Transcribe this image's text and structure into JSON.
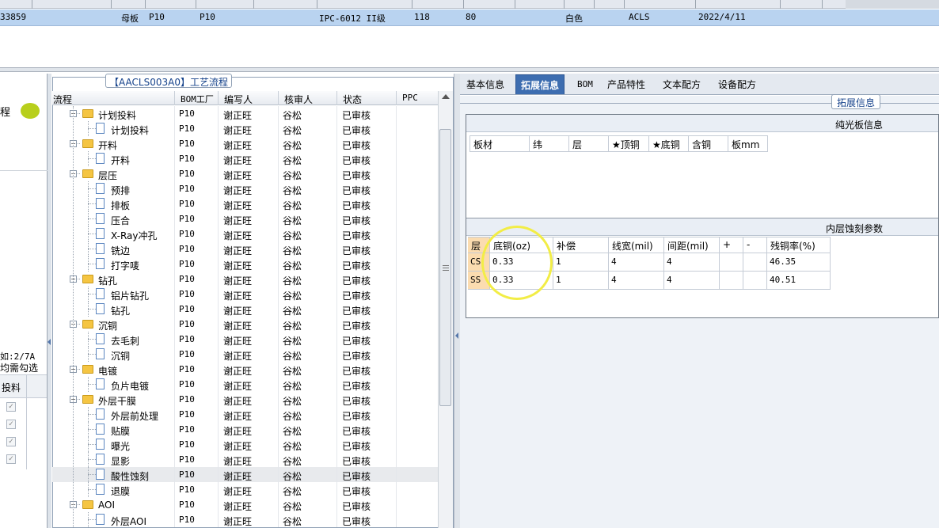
{
  "top_row": {
    "code": "33859",
    "type": "母板",
    "factory": "P10",
    "factory2": "P10",
    "grade": "IPC-6012 II级",
    "num1": "118",
    "num2": "80",
    "color": "白色",
    "brand": "ACLS",
    "date": "2022/4/11"
  },
  "left_panel": {
    "label_cheng": "程",
    "note_line1": "如:2/7A",
    "note_line2": "均需勾选",
    "col_feed": "投料"
  },
  "flow": {
    "title": "【AACLS003A0】工艺流程",
    "headers": [
      "流程",
      "BOM工厂",
      "编写人",
      "核审人",
      "状态",
      "PPC"
    ],
    "rows": [
      {
        "name": "计划投料",
        "level": 0,
        "factory": "P10",
        "writer": "谢正旺",
        "reviewer": "谷松",
        "status": "已审核"
      },
      {
        "name": "计划投料",
        "level": 1,
        "factory": "P10",
        "writer": "谢正旺",
        "reviewer": "谷松",
        "status": "已审核"
      },
      {
        "name": "开料",
        "level": 0,
        "factory": "P10",
        "writer": "谢正旺",
        "reviewer": "谷松",
        "status": "已审核"
      },
      {
        "name": "开料",
        "level": 1,
        "factory": "P10",
        "writer": "谢正旺",
        "reviewer": "谷松",
        "status": "已审核"
      },
      {
        "name": "层压",
        "level": 0,
        "factory": "P10",
        "writer": "谢正旺",
        "reviewer": "谷松",
        "status": "已审核"
      },
      {
        "name": "预排",
        "level": 1,
        "factory": "P10",
        "writer": "谢正旺",
        "reviewer": "谷松",
        "status": "已审核"
      },
      {
        "name": "排板",
        "level": 1,
        "factory": "P10",
        "writer": "谢正旺",
        "reviewer": "谷松",
        "status": "已审核"
      },
      {
        "name": "压合",
        "level": 1,
        "factory": "P10",
        "writer": "谢正旺",
        "reviewer": "谷松",
        "status": "已审核"
      },
      {
        "name": "X-Ray冲孔",
        "level": 1,
        "factory": "P10",
        "writer": "谢正旺",
        "reviewer": "谷松",
        "status": "已审核"
      },
      {
        "name": "铣边",
        "level": 1,
        "factory": "P10",
        "writer": "谢正旺",
        "reviewer": "谷松",
        "status": "已审核"
      },
      {
        "name": "打字唛",
        "level": 1,
        "factory": "P10",
        "writer": "谢正旺",
        "reviewer": "谷松",
        "status": "已审核"
      },
      {
        "name": "钻孔",
        "level": 0,
        "factory": "P10",
        "writer": "谢正旺",
        "reviewer": "谷松",
        "status": "已审核"
      },
      {
        "name": "铝片钻孔",
        "level": 1,
        "factory": "P10",
        "writer": "谢正旺",
        "reviewer": "谷松",
        "status": "已审核"
      },
      {
        "name": "钻孔",
        "level": 1,
        "factory": "P10",
        "writer": "谢正旺",
        "reviewer": "谷松",
        "status": "已审核"
      },
      {
        "name": "沉铜",
        "level": 0,
        "factory": "P10",
        "writer": "谢正旺",
        "reviewer": "谷松",
        "status": "已审核"
      },
      {
        "name": "去毛刺",
        "level": 1,
        "factory": "P10",
        "writer": "谢正旺",
        "reviewer": "谷松",
        "status": "已审核"
      },
      {
        "name": "沉铜",
        "level": 1,
        "factory": "P10",
        "writer": "谢正旺",
        "reviewer": "谷松",
        "status": "已审核"
      },
      {
        "name": "电镀",
        "level": 0,
        "factory": "P10",
        "writer": "谢正旺",
        "reviewer": "谷松",
        "status": "已审核"
      },
      {
        "name": "负片电镀",
        "level": 1,
        "factory": "P10",
        "writer": "谢正旺",
        "reviewer": "谷松",
        "status": "已审核"
      },
      {
        "name": "外层干膜",
        "level": 0,
        "factory": "P10",
        "writer": "谢正旺",
        "reviewer": "谷松",
        "status": "已审核"
      },
      {
        "name": "外层前处理",
        "level": 1,
        "factory": "P10",
        "writer": "谢正旺",
        "reviewer": "谷松",
        "status": "已审核"
      },
      {
        "name": "贴膜",
        "level": 1,
        "factory": "P10",
        "writer": "谢正旺",
        "reviewer": "谷松",
        "status": "已审核"
      },
      {
        "name": "曝光",
        "level": 1,
        "factory": "P10",
        "writer": "谢正旺",
        "reviewer": "谷松",
        "status": "已审核"
      },
      {
        "name": "显影",
        "level": 1,
        "factory": "P10",
        "writer": "谢正旺",
        "reviewer": "谷松",
        "status": "已审核"
      },
      {
        "name": "酸性蚀刻",
        "level": 1,
        "factory": "P10",
        "writer": "谢正旺",
        "reviewer": "谷松",
        "status": "已审核",
        "selected": true
      },
      {
        "name": "退膜",
        "level": 1,
        "factory": "P10",
        "writer": "谢正旺",
        "reviewer": "谷松",
        "status": "已审核"
      },
      {
        "name": "AOI",
        "level": 0,
        "factory": "P10",
        "writer": "谢正旺",
        "reviewer": "谷松",
        "status": "已审核"
      },
      {
        "name": "外层AOI",
        "level": 1,
        "factory": "P10",
        "writer": "谢正旺",
        "reviewer": "谷松",
        "status": "已审核"
      }
    ]
  },
  "tabs": [
    {
      "label": "基本信息",
      "active": false
    },
    {
      "label": "拓展信息",
      "active": true
    },
    {
      "label": "BOM",
      "active": false
    },
    {
      "label": "产品特性",
      "active": false
    },
    {
      "label": "文本配方",
      "active": false
    },
    {
      "label": "设备配方",
      "active": false
    }
  ],
  "ext": {
    "legend": "拓展信息",
    "light_board": {
      "title": "纯光板信息",
      "headers": [
        "板材",
        "纬",
        "层",
        "★顶铜",
        "★底铜",
        "含铜",
        "板mm"
      ]
    },
    "inner_etch": {
      "title": "内层蚀刻参数",
      "headers": [
        "层",
        "底铜(oz)",
        "补偿",
        "线宽(mil)",
        "间距(mil)",
        "+",
        "-",
        "残铜率(%)"
      ],
      "rows": [
        {
          "layer": "CS",
          "base_cu": "0.33",
          "comp": "1",
          "width": "4",
          "spacing": "4",
          "plus": "",
          "minus": "",
          "residual": "46.35"
        },
        {
          "layer": "SS",
          "base_cu": "0.33",
          "comp": "1",
          "width": "4",
          "spacing": "4",
          "plus": "",
          "minus": "",
          "residual": "40.51"
        }
      ]
    }
  },
  "colors": {
    "selected_row": "#b9d3f0",
    "active_tab": "#3d6db0",
    "folder": "#f5c542",
    "highlight_circle": "#f2ed46",
    "layer_header": "#fbdcb0"
  }
}
